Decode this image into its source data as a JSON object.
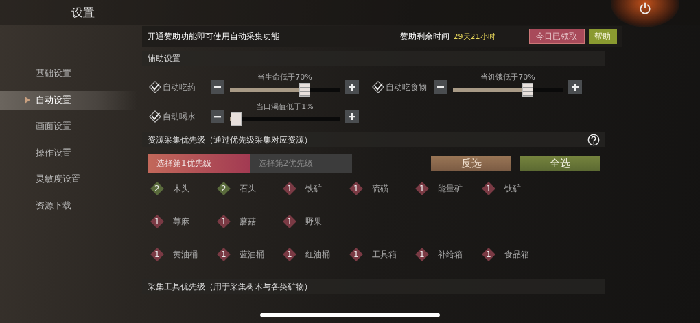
{
  "header": {
    "title": "设置"
  },
  "sidebar": {
    "items": [
      {
        "label": "基础设置",
        "selected": false
      },
      {
        "label": "自动设置",
        "selected": true
      },
      {
        "label": "画面设置",
        "selected": false
      },
      {
        "label": "操作设置",
        "selected": false
      },
      {
        "label": "灵敏度设置",
        "selected": false
      },
      {
        "label": "资源下载",
        "selected": false
      }
    ]
  },
  "sponsor": {
    "notice": "开通赞助功能即可使用自动采集功能",
    "remaining_label": "赞助剩余时间",
    "remaining_value": "29天21小时",
    "claim_button": "今日已领取",
    "help_button": "帮助"
  },
  "assist": {
    "title": "辅助设置",
    "sliders": [
      {
        "label": "自动吃药",
        "checked": true,
        "caption": "当生命低于70%",
        "level": 0.7
      },
      {
        "label": "自动吃食物",
        "checked": true,
        "caption": "当饥饿低于70%",
        "level": 0.7
      },
      {
        "label": "自动喝水",
        "checked": true,
        "caption": "当口渴值低于1%",
        "level": 0.01
      }
    ]
  },
  "resources": {
    "title": "资源采集优先级（通过优先级采集对应资源）",
    "tabs": [
      {
        "label": "选择第1优先级",
        "selected": true
      },
      {
        "label": "选择第2优先级",
        "selected": false
      }
    ],
    "invert_button": "反选",
    "select_all_button": "全选",
    "rows": [
      [
        {
          "priority": "2",
          "name": "木头",
          "color": "#5a6b3c"
        },
        {
          "priority": "2",
          "name": "石头",
          "color": "#5a6b3c"
        },
        {
          "priority": "1",
          "name": "铁矿",
          "color": "#7a3a44"
        },
        {
          "priority": "1",
          "name": "硫磺",
          "color": "#7a3a44"
        },
        {
          "priority": "1",
          "name": "能量矿",
          "color": "#7a3a44"
        },
        {
          "priority": "1",
          "name": "钛矿",
          "color": "#7a3a44"
        }
      ],
      [
        {
          "priority": "1",
          "name": "荨麻",
          "color": "#7a3a44"
        },
        {
          "priority": "1",
          "name": "蘑菇",
          "color": "#7a3a44"
        },
        {
          "priority": "1",
          "name": "野果",
          "color": "#7a3a44"
        }
      ],
      [
        {
          "priority": "1",
          "name": "黄油桶",
          "color": "#7a3a44"
        },
        {
          "priority": "1",
          "name": "蓝油桶",
          "color": "#7a3a44"
        },
        {
          "priority": "1",
          "name": "红油桶",
          "color": "#7a3a44"
        },
        {
          "priority": "1",
          "name": "工具箱",
          "color": "#7a3a44"
        },
        {
          "priority": "1",
          "name": "补给箱",
          "color": "#7a3a44"
        },
        {
          "priority": "1",
          "name": "食品箱",
          "color": "#7a3a44"
        }
      ]
    ]
  },
  "tools": {
    "title": "采集工具优先级（用于采集树木与各类矿物）"
  }
}
